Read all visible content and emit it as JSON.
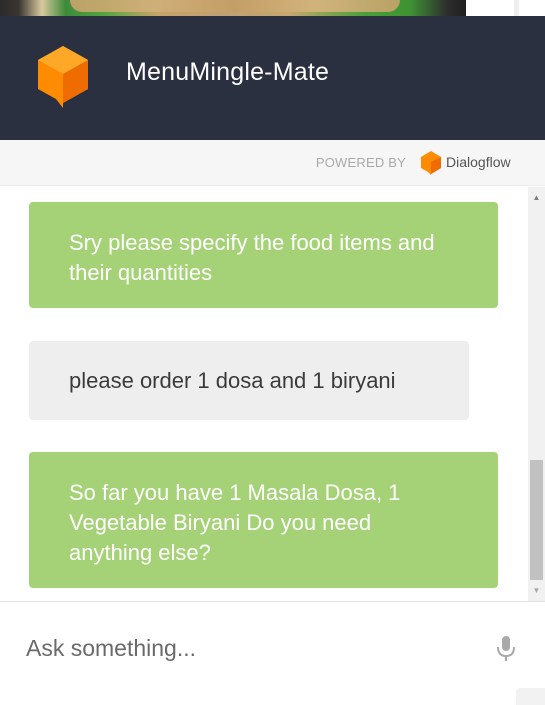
{
  "app": {
    "title": "MenuMingle-Mate",
    "brand_color": "#2b3040",
    "logo_color": "#ff8c00"
  },
  "powered_by": {
    "label": "POWERED BY",
    "provider": "Dialogflow"
  },
  "messages": [
    {
      "sender": "bot",
      "text": "Sry please specify the food items and their quantities",
      "color": "#a5d276"
    },
    {
      "sender": "user",
      "text": "please order 1 dosa and 1 biryani",
      "color": "#eeeeee"
    },
    {
      "sender": "bot",
      "text": "So far you have 1 Masala Dosa, 1 Vegetable Biryani Do you need anything else?",
      "color": "#a5d276"
    }
  ],
  "input": {
    "placeholder": "Ask something...",
    "value": ""
  },
  "icons": {
    "logo": "dialogflow-logo-icon",
    "mic": "microphone-icon"
  }
}
